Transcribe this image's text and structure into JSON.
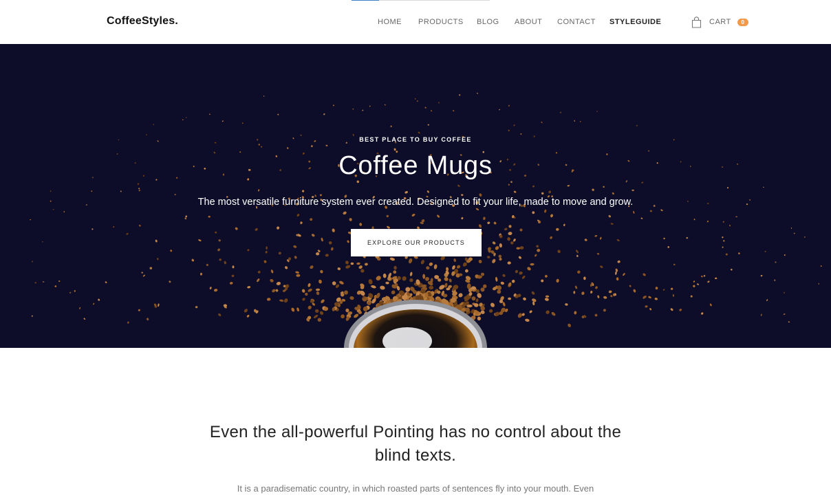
{
  "header": {
    "logo": "CoffeeStyles.",
    "scroll_progress": 0.2,
    "nav": [
      "HOME",
      "PRODUCTS",
      "BLOG",
      "ABOUT",
      "CONTACT",
      "STYLEGUIDE"
    ],
    "active_nav": "STYLEGUIDE",
    "cart_label": "CART",
    "cart_count": "0",
    "cart_icon": "shopping-bag-icon"
  },
  "hero": {
    "eyebrow": "BEST PLACE TO BUY COFFEE",
    "title": "Coffee Mugs",
    "subtitle": "The most versatile furniture system ever created. Designed to fit your life, made to move and grow.",
    "button_label": "EXPLORE OUR PRODUCTS",
    "background_color": "#0e0d29"
  },
  "content": {
    "heading": "Even the all-powerful Pointing has no control about the blind texts.",
    "body": "It is a paradisematic country, in which roasted parts of sentences fly into your mouth. Even"
  },
  "colors": {
    "accent": "#f29a4a",
    "progress": "#3d7fc4"
  }
}
